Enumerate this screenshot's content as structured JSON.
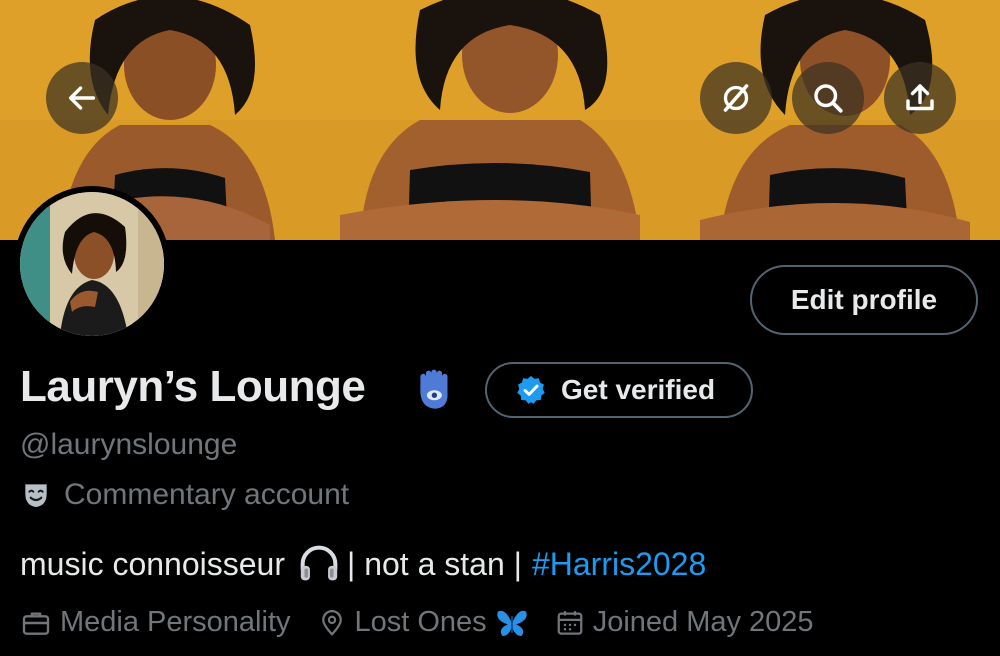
{
  "header": {
    "back_icon": "arrow-left-icon",
    "actions": [
      "grok-icon",
      "search-icon",
      "share-icon"
    ]
  },
  "profile": {
    "name": "Lauryn’s Lounge",
    "name_emoji": "hamsa-icon",
    "handle": "@laurynslounge",
    "category": "Commentary account",
    "bio_text": "music connoisseur",
    "bio_sep": "| not a stan |",
    "bio_hashtag": "#Harris2028",
    "profession": "Media Personality",
    "location": "Lost Ones",
    "joined": "Joined May 2025"
  },
  "buttons": {
    "edit_profile": "Edit profile",
    "get_verified": "Get verified"
  },
  "colors": {
    "background": "#000000",
    "text": "#e7e9ea",
    "muted": "#71767b",
    "link": "#1d9bf0",
    "banner": "#e0a229"
  }
}
